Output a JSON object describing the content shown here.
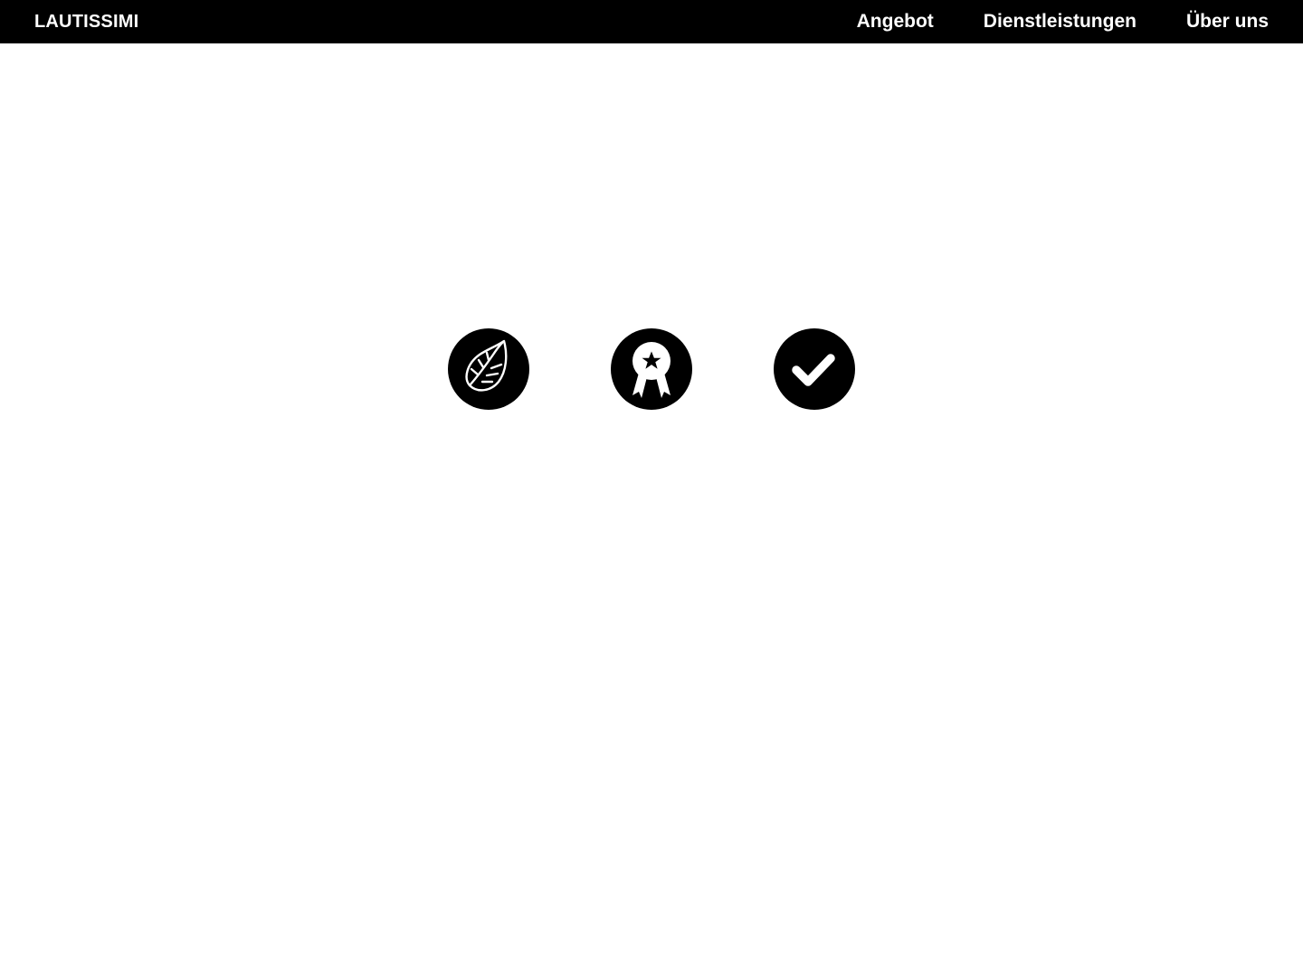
{
  "header": {
    "brand": "LAUTISSIMI",
    "nav": [
      {
        "label": "Angebot"
      },
      {
        "label": "Dienstleistungen"
      },
      {
        "label": "Über uns"
      }
    ]
  },
  "features": {
    "icons": [
      "leaf-icon",
      "award-ribbon-icon",
      "checkmark-icon"
    ]
  },
  "colors": {
    "background": "#ffffff",
    "topbar": "#000000",
    "topbar_text": "#ffffff",
    "badge": "#000000",
    "badge_icon": "#ffffff"
  }
}
